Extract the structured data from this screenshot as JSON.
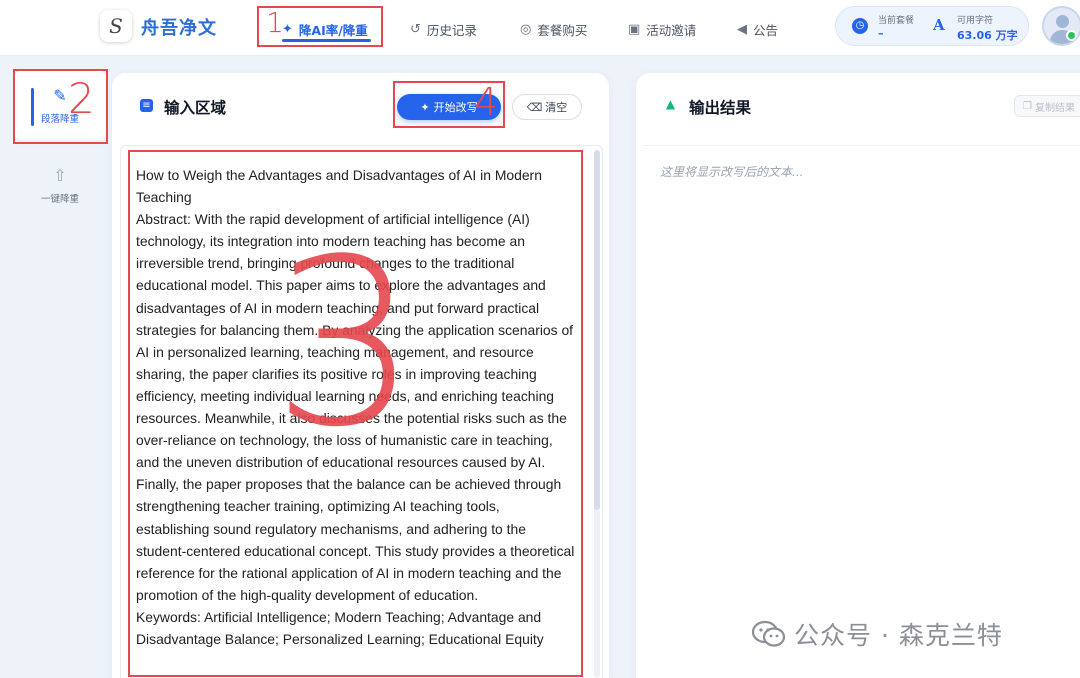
{
  "app": {
    "logo_letter": "S",
    "name": "舟吾净文"
  },
  "nav": {
    "items": [
      {
        "label": "降AI率/降重",
        "icon": "magic-wand-icon"
      },
      {
        "label": "历史记录",
        "icon": "history-icon"
      },
      {
        "label": "套餐购买",
        "icon": "package-icon"
      },
      {
        "label": "活动邀请",
        "icon": "gift-icon"
      },
      {
        "label": "公告",
        "icon": "megaphone-icon"
      }
    ]
  },
  "plan": {
    "current_label": "当前套餐",
    "current_value": "–",
    "chars_icon": "A",
    "chars_label": "可用字符",
    "chars_value": "63.06 万字"
  },
  "sidebar": {
    "items": [
      {
        "label": "段落降重",
        "icon": "edit-paragraph-icon"
      },
      {
        "label": "一键降重",
        "icon": "upload-file-icon"
      }
    ]
  },
  "input_panel": {
    "title": "输入区域",
    "start_label": "开始改写",
    "clear_label": "清空",
    "paragraphs": [
      "How to Weigh the Advantages and Disadvantages of AI in Modern Teaching",
      "Abstract: With the rapid development of artificial intelligence (AI) technology, its integration into modern teaching has become an irreversible trend, bringing profound changes to the traditional educational model. This paper aims to explore the advantages and disadvantages of AI in modern teaching, and put forward practical strategies for balancing them. By analyzing the application scenarios of AI in personalized learning, teaching management, and resource sharing, the paper clarifies its positive roles in improving teaching efficiency, meeting individual learning needs, and enriching teaching resources. Meanwhile, it also discusses the potential risks such as the over-reliance on technology, the loss of humanistic care in teaching, and the uneven distribution of educational resources caused by AI. Finally, the paper proposes that the balance can be achieved through strengthening teacher training, optimizing AI teaching tools, establishing sound regulatory mechanisms, and adhering to the student-centered educational concept. This study provides a theoretical reference for the rational application of AI in modern teaching and the promotion of the high-quality development of education.",
      "Keywords: Artificial Intelligence; Modern Teaching; Advantage and Disadvantage Balance; Personalized Learning; Educational Equity"
    ]
  },
  "output_panel": {
    "title": "输出结果",
    "copy_label": "复制结果",
    "placeholder": "这里将显示改写后的文本..."
  },
  "annotations": {
    "n1": "1",
    "n2": "2",
    "n3": "3",
    "n4": "4",
    "color": "#e5484d"
  },
  "watermark": {
    "text": "公众号 · 森克兰特"
  },
  "colors": {
    "accent": "#2563eb",
    "background": "#eef3fa"
  }
}
